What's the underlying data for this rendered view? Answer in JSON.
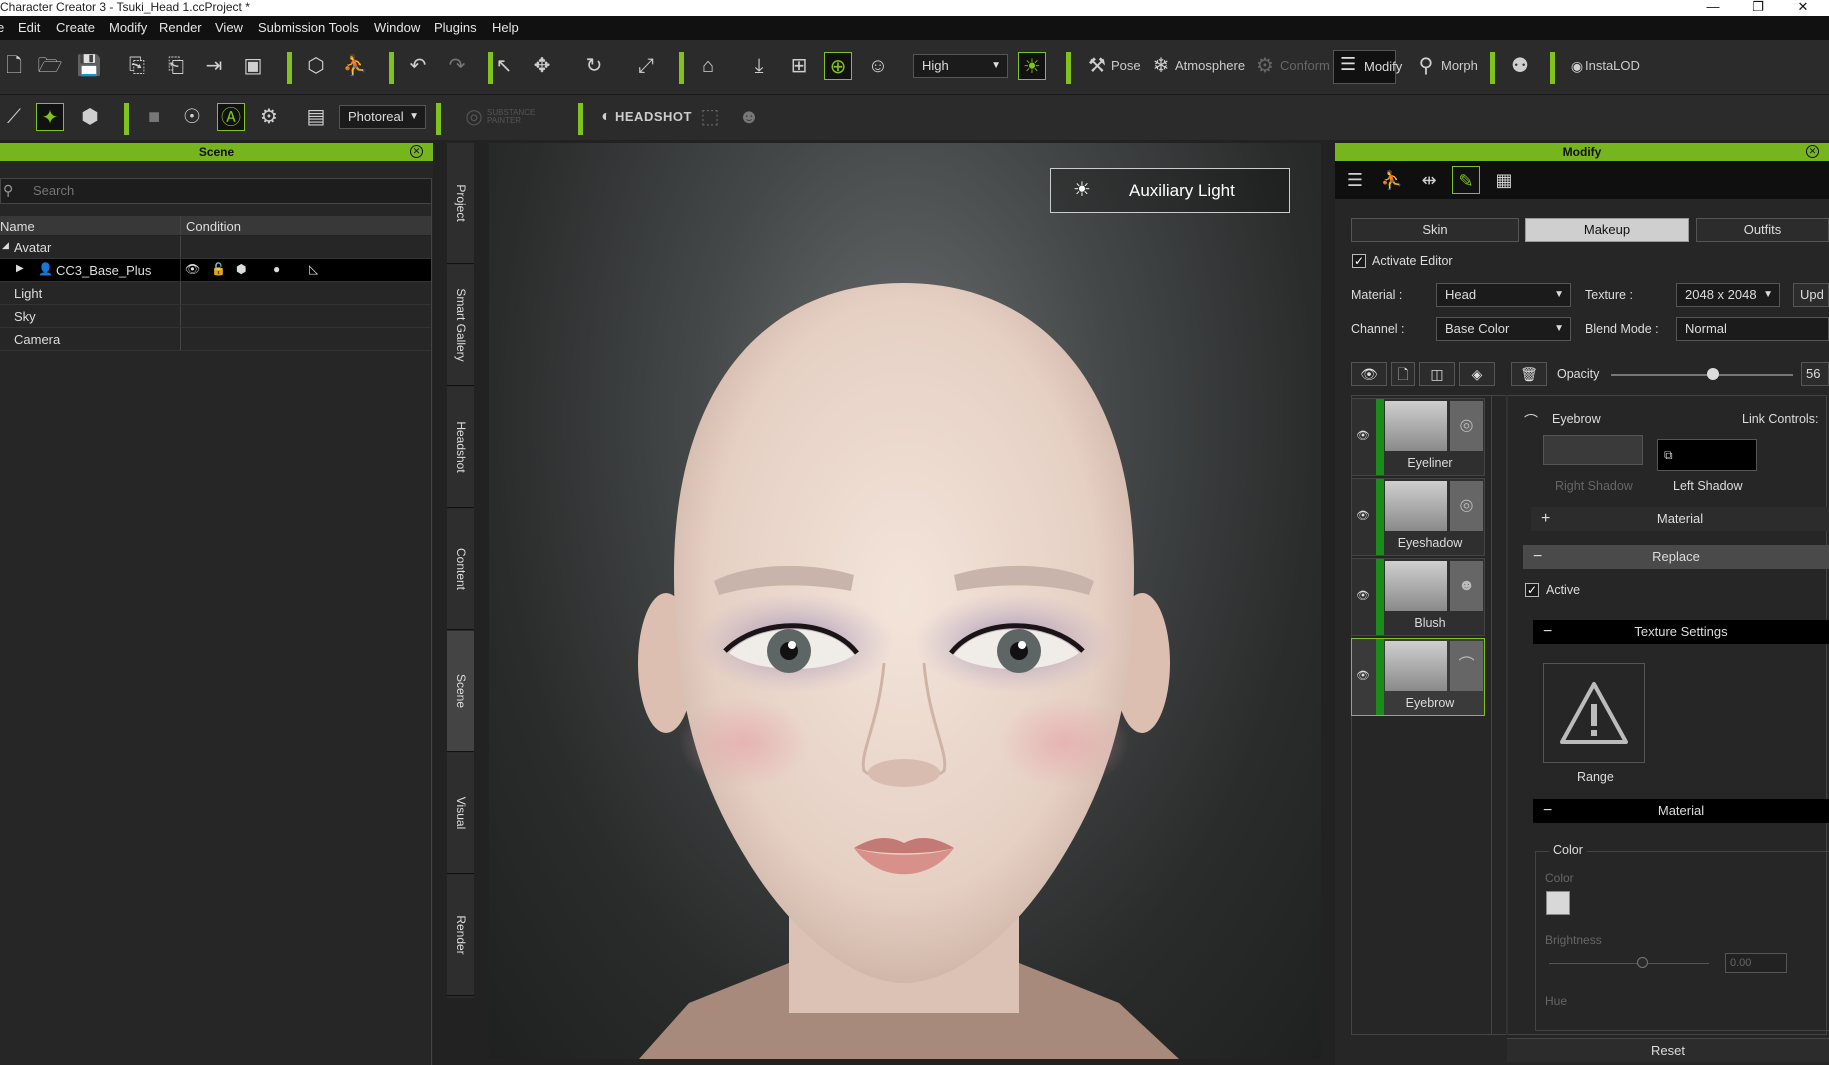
{
  "window": {
    "title": "Character Creator 3 - Tsuki_Head 1.ccProject *",
    "minimize": "—",
    "maximize": "❐",
    "close": "✕"
  },
  "menu": [
    "Edit",
    "Create",
    "Modify",
    "Render",
    "View",
    "Submission Tools",
    "Window",
    "Plugins",
    "Help"
  ],
  "toolbar": {
    "quality": "High",
    "pose": "Pose",
    "atmosphere": "Atmosphere",
    "conform": "Conform",
    "modify": "Modify",
    "morph": "Morph",
    "instalod": "InstaLOD",
    "render_mode": "Photoreal",
    "substance": "SUBSTANCE PAINTER",
    "headshot": "HEADSHOT"
  },
  "scene": {
    "title": "Scene",
    "search_placeholder": "Search",
    "columns": {
      "name": "Name",
      "condition": "Condition"
    },
    "rows": [
      "Avatar",
      "CC3_Base_Plus",
      "Light",
      "Sky",
      "Camera"
    ]
  },
  "side_tabs": [
    "Project",
    "Smart Gallery",
    "Headshot",
    "Content",
    "Scene",
    "Visual",
    "Render"
  ],
  "viewport": {
    "aux_light": "Auxiliary Light"
  },
  "modify": {
    "title": "Modify",
    "tabs": {
      "skin": "Skin",
      "makeup": "Makeup",
      "outfits": "Outfits"
    },
    "activate_editor": "Activate Editor",
    "material_label": "Material :",
    "material_value": "Head",
    "texture_label": "Texture :",
    "texture_value": "2048 x 2048",
    "upd": "Upd",
    "channel_label": "Channel :",
    "channel_value": "Base Color",
    "blend_label": "Blend Mode :",
    "blend_value": "Normal",
    "opacity_label": "Opacity",
    "opacity_value": "56",
    "opacity_fraction": 0.56,
    "layers": [
      "Eyeliner",
      "Eyeshadow",
      "Blush",
      "Eyebrow"
    ],
    "detail": {
      "current": "Eyebrow",
      "link_controls": "Link Controls:",
      "right_shadow": "Right Shadow",
      "left_shadow": "Left Shadow",
      "material_section": "Material",
      "replace": "Replace",
      "active": "Active",
      "texture_settings": "Texture Settings",
      "range": "Range",
      "material_section2": "Material",
      "color_group": "Color",
      "color_label": "Color",
      "brightness_label": "Brightness",
      "brightness_value": "0.00",
      "hue_label": "Hue",
      "reset": "Reset"
    }
  }
}
